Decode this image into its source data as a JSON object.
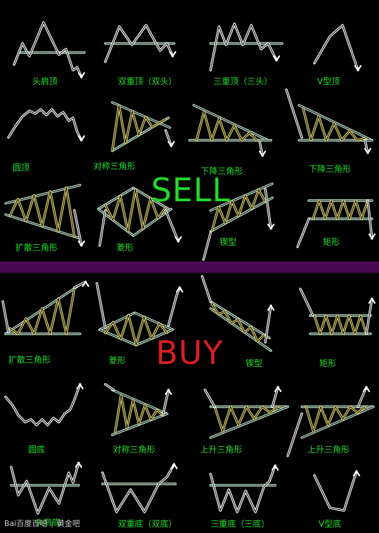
{
  "sell_label": "SELL",
  "buy_label": "BUY",
  "colors": {
    "sell": "#22d82a",
    "buy": "#d81f1f",
    "label": "#22e02a",
    "divider": "#4a0a52",
    "line": "#ffffff",
    "hatch": "#e4d870",
    "trend": "#c8f0d8"
  },
  "sell_patterns": [
    {
      "label": "头肩顶",
      "icon": "head-and-shoulders-top"
    },
    {
      "label": "双重顶（双头）",
      "icon": "double-top"
    },
    {
      "label": "三重顶（三头）",
      "icon": "triple-top"
    },
    {
      "label": "V型顶",
      "icon": "v-top"
    },
    {
      "label": "圆顶",
      "icon": "rounded-top"
    },
    {
      "label": "对称三角形",
      "icon": "symmetrical-triangle-sell"
    },
    {
      "label": "下降三角形",
      "icon": "descending-triangle-a"
    },
    {
      "label": "下降三角形",
      "icon": "descending-triangle-b"
    },
    {
      "label": "扩散三角形",
      "icon": "broadening-triangle-sell"
    },
    {
      "label": "菱形",
      "icon": "diamond-sell"
    },
    {
      "label": "锲型",
      "icon": "wedge-sell"
    },
    {
      "label": "矩形",
      "icon": "rectangle-sell"
    }
  ],
  "buy_patterns": [
    {
      "label": "扩散三角形",
      "icon": "broadening-triangle-buy"
    },
    {
      "label": "菱形",
      "icon": "diamond-buy"
    },
    {
      "label": "锲型",
      "icon": "wedge-buy"
    },
    {
      "label": "矩形",
      "icon": "rectangle-buy"
    },
    {
      "label": "圆底",
      "icon": "rounded-bottom"
    },
    {
      "label": "对称三角形",
      "icon": "symmetrical-triangle-buy"
    },
    {
      "label": "上升三角形",
      "icon": "ascending-triangle-a"
    },
    {
      "label": "上升三角形",
      "icon": "ascending-triangle-b"
    },
    {
      "label": "头肩底",
      "icon": "head-and-shoulders-bottom"
    },
    {
      "label": "双重底（双底）",
      "icon": "double-bottom"
    },
    {
      "label": "三重底（三底）",
      "icon": "triple-bottom"
    },
    {
      "label": "V型底",
      "icon": "v-bottom"
    }
  ],
  "watermark": {
    "brand": "Bai百度",
    "product": "百吧",
    "forum": "黄金吧"
  }
}
